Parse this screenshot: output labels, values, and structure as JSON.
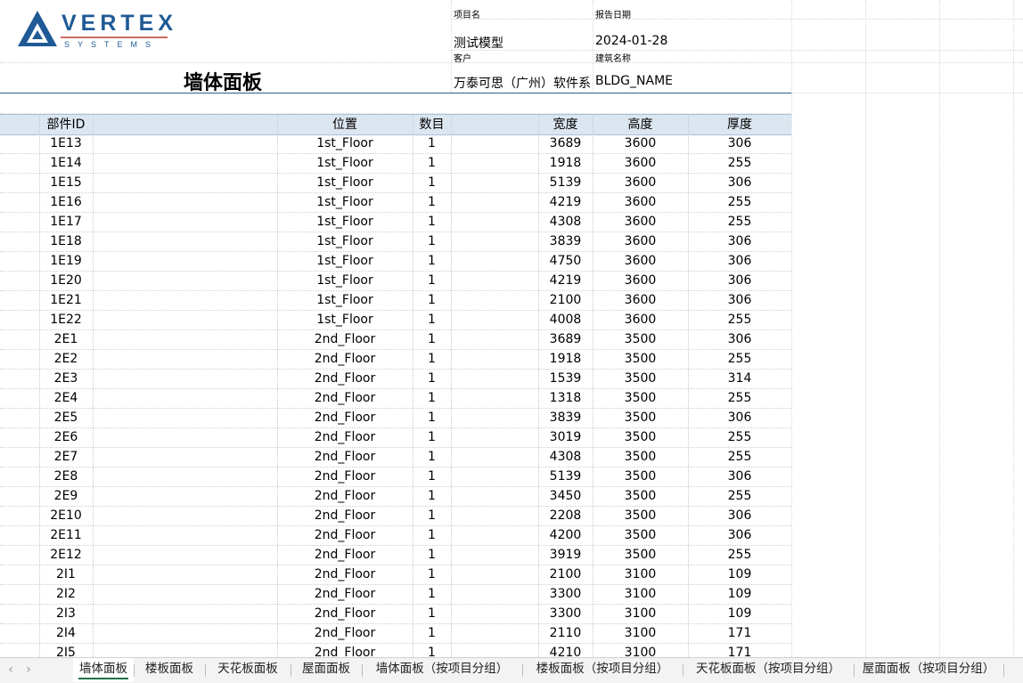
{
  "header": {
    "logo_text": "VERTEX",
    "logo_sub": "SYSTEMS",
    "sheet_title": "墙体面板",
    "project_name_label": "项目名",
    "project_name_value": "测试模型",
    "report_date_label": "报告日期",
    "report_date_value": "2024-01-28",
    "client_label": "客户",
    "client_value": "万泰可思（广州）软件系",
    "building_label": "建筑名称",
    "building_value": "BLDG_NAME"
  },
  "table": {
    "columns": [
      "部件ID",
      "位置",
      "数目",
      "宽度",
      "高度",
      "厚度"
    ],
    "rows": [
      [
        "1E13",
        "1st_Floor",
        "1",
        "3689",
        "3600",
        "306"
      ],
      [
        "1E14",
        "1st_Floor",
        "1",
        "1918",
        "3600",
        "255"
      ],
      [
        "1E15",
        "1st_Floor",
        "1",
        "5139",
        "3600",
        "306"
      ],
      [
        "1E16",
        "1st_Floor",
        "1",
        "4219",
        "3600",
        "255"
      ],
      [
        "1E17",
        "1st_Floor",
        "1",
        "4308",
        "3600",
        "255"
      ],
      [
        "1E18",
        "1st_Floor",
        "1",
        "3839",
        "3600",
        "306"
      ],
      [
        "1E19",
        "1st_Floor",
        "1",
        "4750",
        "3600",
        "306"
      ],
      [
        "1E20",
        "1st_Floor",
        "1",
        "4219",
        "3600",
        "306"
      ],
      [
        "1E21",
        "1st_Floor",
        "1",
        "2100",
        "3600",
        "306"
      ],
      [
        "1E22",
        "1st_Floor",
        "1",
        "4008",
        "3600",
        "255"
      ],
      [
        "2E1",
        "2nd_Floor",
        "1",
        "3689",
        "3500",
        "306"
      ],
      [
        "2E2",
        "2nd_Floor",
        "1",
        "1918",
        "3500",
        "255"
      ],
      [
        "2E3",
        "2nd_Floor",
        "1",
        "1539",
        "3500",
        "314"
      ],
      [
        "2E4",
        "2nd_Floor",
        "1",
        "1318",
        "3500",
        "255"
      ],
      [
        "2E5",
        "2nd_Floor",
        "1",
        "3839",
        "3500",
        "306"
      ],
      [
        "2E6",
        "2nd_Floor",
        "1",
        "3019",
        "3500",
        "255"
      ],
      [
        "2E7",
        "2nd_Floor",
        "1",
        "4308",
        "3500",
        "255"
      ],
      [
        "2E8",
        "2nd_Floor",
        "1",
        "5139",
        "3500",
        "306"
      ],
      [
        "2E9",
        "2nd_Floor",
        "1",
        "3450",
        "3500",
        "255"
      ],
      [
        "2E10",
        "2nd_Floor",
        "1",
        "2208",
        "3500",
        "306"
      ],
      [
        "2E11",
        "2nd_Floor",
        "1",
        "4200",
        "3500",
        "306"
      ],
      [
        "2E12",
        "2nd_Floor",
        "1",
        "3919",
        "3500",
        "255"
      ],
      [
        "2I1",
        "2nd_Floor",
        "1",
        "2100",
        "3100",
        "109"
      ],
      [
        "2I2",
        "2nd_Floor",
        "1",
        "3300",
        "3100",
        "109"
      ],
      [
        "2I3",
        "2nd_Floor",
        "1",
        "3300",
        "3100",
        "109"
      ],
      [
        "2I4",
        "2nd_Floor",
        "1",
        "2110",
        "3100",
        "171"
      ],
      [
        "2I5",
        "2nd_Floor",
        "1",
        "4210",
        "3100",
        "171"
      ]
    ]
  },
  "tabs": [
    {
      "label": "墙体面板",
      "active": true
    },
    {
      "label": "楼板面板",
      "active": false
    },
    {
      "label": "天花板面板",
      "active": false
    },
    {
      "label": "屋面面板",
      "active": false
    },
    {
      "label": "墙体面板（按项目分组）",
      "active": false
    },
    {
      "label": "楼板面板（按项目分组）",
      "active": false
    },
    {
      "label": "天花板面板（按项目分组）",
      "active": false
    },
    {
      "label": "屋面面板（按项目分组）",
      "active": false
    }
  ],
  "nav": {
    "prev_icon": "chevron-left-icon",
    "next_icon": "chevron-right-icon"
  },
  "colors": {
    "header_fill": "#dce6f1",
    "active_tab_underline": "#1e7145",
    "logo_blue": "#1f5a96",
    "logo_red": "#c0392b"
  }
}
